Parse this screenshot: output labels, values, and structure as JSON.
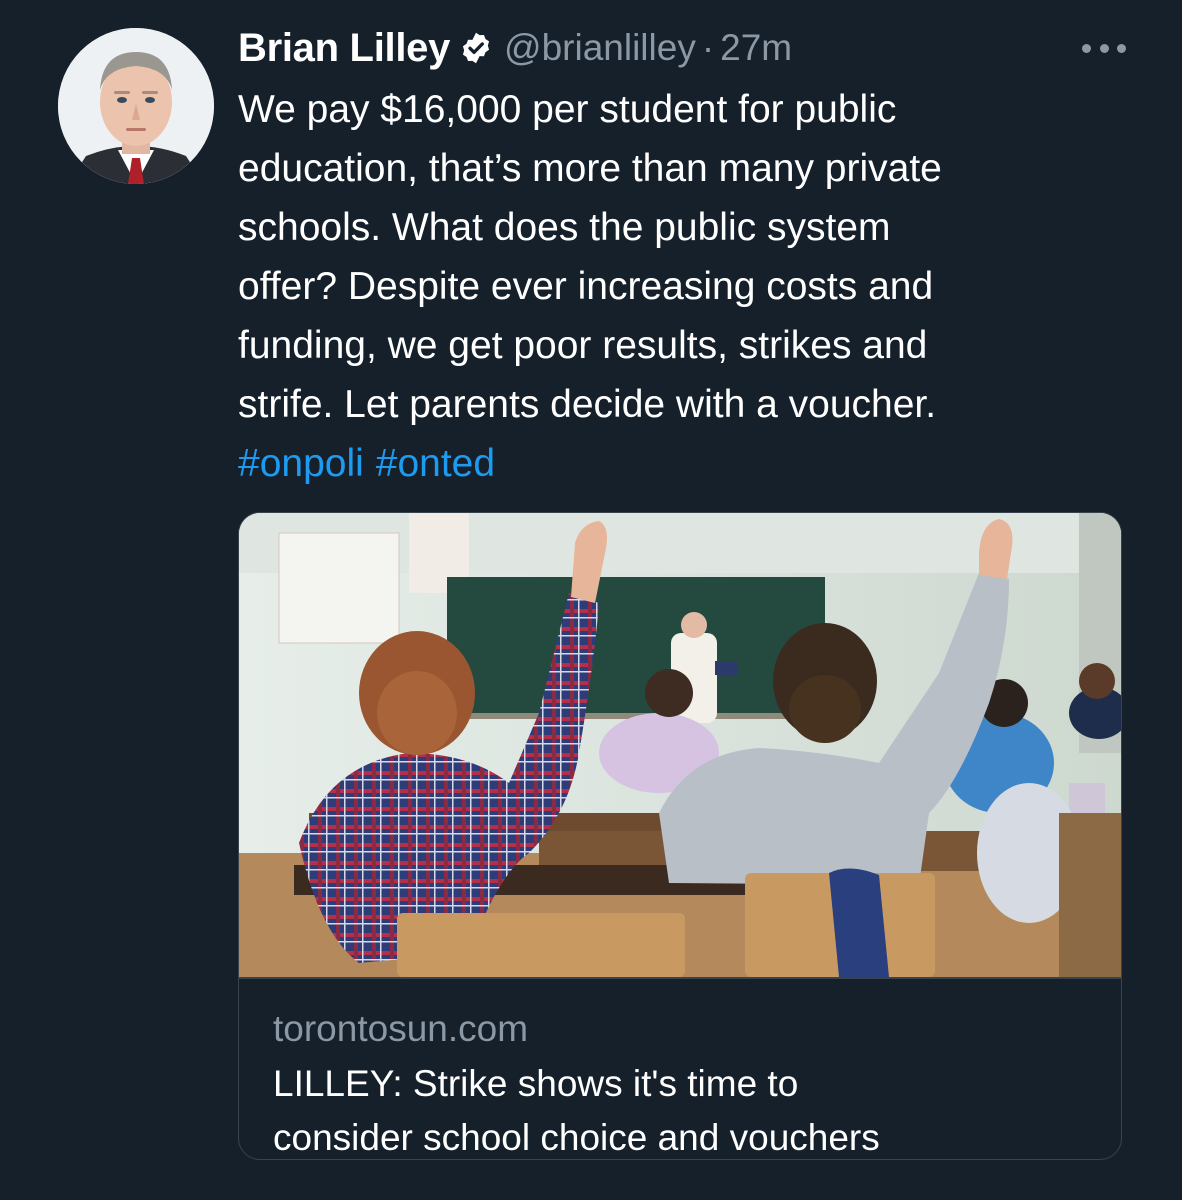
{
  "tweet": {
    "author_name": "Brian Lilley",
    "author_handle": "@brianlilley",
    "separator": "·",
    "time": "27m",
    "verified": true,
    "text_lines": [
      "We pay $16,000 per student for public",
      "education, that’s more than many private",
      "schools. What does the public system",
      "offer? Despite ever increasing costs and",
      "funding, we get poor results, strikes and",
      "strife. Let parents decide with a voucher."
    ],
    "hashtags": [
      "#onpoli",
      "#onted"
    ]
  },
  "card": {
    "domain": "torontosun.com",
    "title_lines": [
      "LILLEY: Strike shows it's time to",
      "consider school choice and vouchers"
    ]
  },
  "icons": {
    "verified": "verified-badge-icon",
    "more": "more-options-icon"
  },
  "colors": {
    "background": "#15202b",
    "link": "#1d9bf0",
    "muted": "#8b98a5",
    "border": "#38444d"
  }
}
